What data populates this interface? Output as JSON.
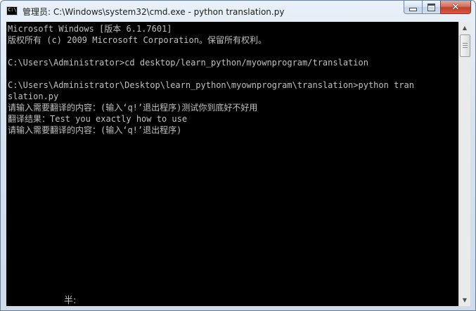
{
  "window": {
    "title": "管理员: C:\\Windows\\system32\\cmd.exe - python  translation.py",
    "icon": "cmd-icon",
    "controls": {
      "minimize": "minimize-icon",
      "maximize": "maximize-icon",
      "close": "close-icon",
      "close_glyph": "✕"
    }
  },
  "console": {
    "background": "#000000",
    "foreground": "#c0c0c0",
    "lines": [
      "Microsoft Windows [版本 6.1.7601]",
      "版权所有 (c) 2009 Microsoft Corporation。保留所有权利。",
      "",
      "C:\\Users\\Administrator>cd desktop/learn_python/myownprogram/translation",
      "",
      "C:\\Users\\Administrator\\Desktop\\learn_python\\myownprogram\\translation>python tran",
      "slation.py",
      "请输入需要翻译的内容：(输入‘q!’退出程序)测试你到底好不好用",
      "翻译结果：Test you exactly how to use",
      "请输入需要翻译的内容：(输入‘q!’退出程序)"
    ],
    "ime_status": "半:"
  },
  "scrollbar": {
    "up_arrow": "▲",
    "down_arrow": "▼"
  }
}
